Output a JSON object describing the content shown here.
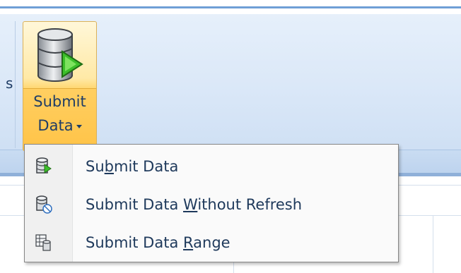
{
  "ribbon": {
    "previous_group_label_fragment": "s",
    "submit_button": {
      "label_line1": "Submit",
      "label_line2": "Data",
      "icon": "database-submit-icon"
    }
  },
  "menu": {
    "items": [
      {
        "label": "Submit Data",
        "access_key": "b",
        "icon": "database-submit-icon"
      },
      {
        "label": "Submit Data Without Refresh",
        "access_key": "W",
        "icon": "database-no-refresh-icon"
      },
      {
        "label": "Submit Data Range",
        "access_key": "R",
        "icon": "database-range-icon"
      }
    ]
  },
  "colors": {
    "ribbon_bg": "#dbe8f8",
    "button_highlight": "#ffd66f",
    "menu_text": "#1e395b",
    "menu_border": "#868686"
  }
}
